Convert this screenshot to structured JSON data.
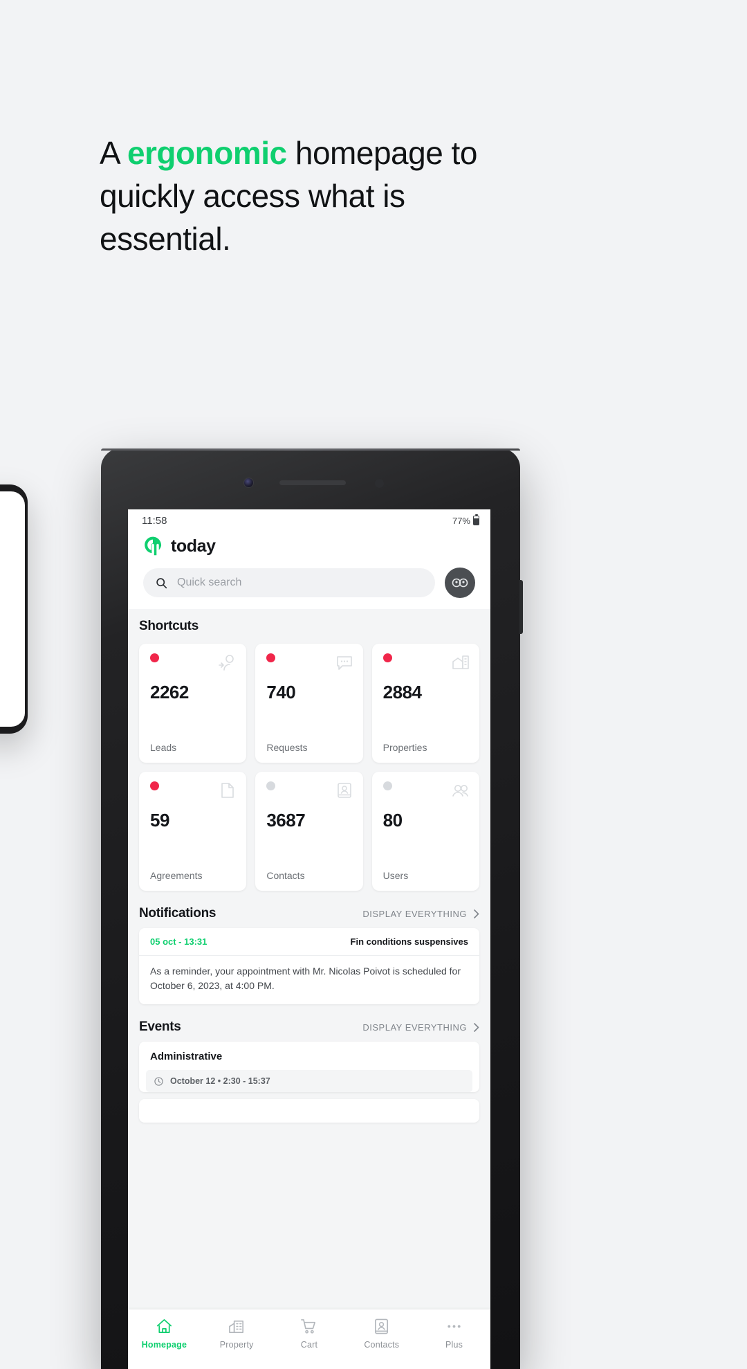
{
  "promo": {
    "headline_pre": "A ",
    "headline_accent": "ergonomic",
    "headline_post": " homepage to quickly access what is essential."
  },
  "colors": {
    "accent_green": "#0fcf6f",
    "alert_red": "#f0264a",
    "muted_grey": "#d7dade",
    "page_bg": "#f2f3f5"
  },
  "statusbar": {
    "time": "11:58",
    "battery_percent": "77%",
    "battery_icon": "battery-icon"
  },
  "header": {
    "logo_icon": "app-logo-icon",
    "app_name": "today",
    "search_placeholder": "Quick search",
    "search_icon": "search-icon",
    "avatar_icon": "user-avatar-icon"
  },
  "shortcuts": {
    "title": "Shortcuts",
    "cards": [
      {
        "value": "2262",
        "label": "Leads",
        "dot": "red",
        "icon": "person-add-icon"
      },
      {
        "value": "740",
        "label": "Requests",
        "dot": "red",
        "icon": "chat-bubble-icon"
      },
      {
        "value": "2884",
        "label": "Properties",
        "dot": "red",
        "icon": "building-home-icon"
      },
      {
        "value": "59",
        "label": "Agreements",
        "dot": "red",
        "icon": "document-icon"
      },
      {
        "value": "3687",
        "label": "Contacts",
        "dot": "grey",
        "icon": "contact-card-icon"
      },
      {
        "value": "80",
        "label": "Users",
        "dot": "grey",
        "icon": "users-group-icon"
      }
    ]
  },
  "notifications": {
    "title": "Notifications",
    "display_all_label": "DISPLAY EVERYTHING",
    "chevron_icon": "chevron-right-icon",
    "items": [
      {
        "date": "05 oct - 13:31",
        "title": "Fin conditions suspensives",
        "body": "As a reminder, your appointment with Mr. Nicolas Poivot is scheduled for October 6, 2023, at 4:00 PM."
      }
    ]
  },
  "events": {
    "title": "Events",
    "display_all_label": "DISPLAY EVERYTHING",
    "chevron_icon": "chevron-right-icon",
    "items": [
      {
        "category": "Administrative",
        "clock_icon": "clock-icon",
        "time": "October 12 • 2:30 - 15:37"
      }
    ]
  },
  "bottom_nav": {
    "items": [
      {
        "label": "Homepage",
        "icon": "home-icon",
        "active": true
      },
      {
        "label": "Property",
        "icon": "building-icon",
        "active": false
      },
      {
        "label": "Cart",
        "icon": "cart-icon",
        "active": false
      },
      {
        "label": "Contacts",
        "icon": "contact-icon",
        "active": false
      },
      {
        "label": "Plus",
        "icon": "more-dots-icon",
        "active": false
      }
    ]
  }
}
